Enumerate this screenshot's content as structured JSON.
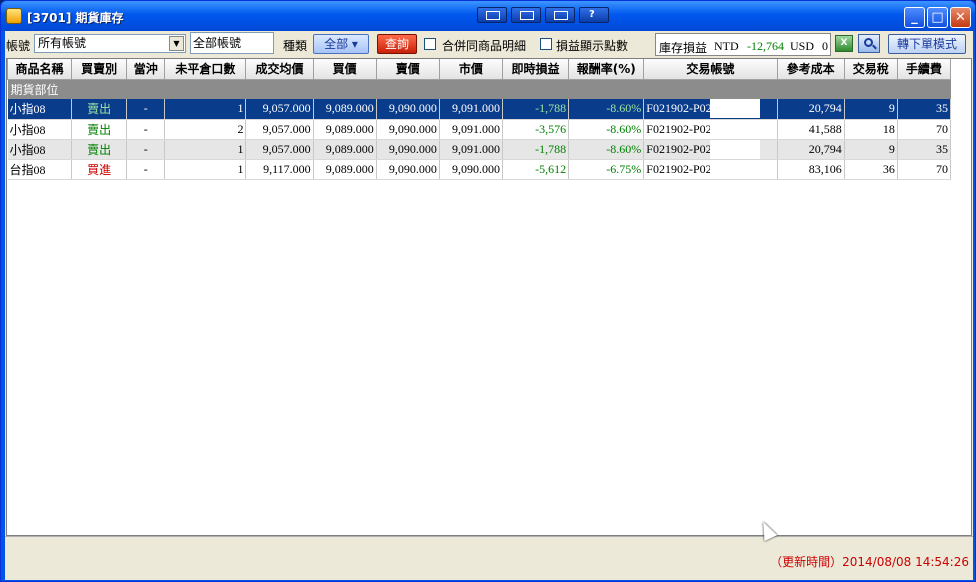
{
  "window": {
    "title": "[3701] 期貨庫存",
    "controls": [
      "minimize",
      "maximize",
      "close"
    ],
    "toolbar_icons": [
      "layout-icon",
      "window-icon",
      "dock-icon",
      "help-icon"
    ],
    "help_label": "?"
  },
  "toolbar": {
    "account_label": "帳號",
    "account_select": "所有帳號",
    "account_text": "全部帳號",
    "type_label": "種類",
    "type_button": "全部",
    "query_button": "查詢",
    "merge_label": "合併同商品明細",
    "points_label": "損益顯示點數",
    "pl_label": "庫存損益",
    "pl_ntd_label": "NTD",
    "pl_ntd_value": "-12,764",
    "pl_usd_label": "USD",
    "pl_usd_value": "0",
    "order_mode_button": "轉下單模式",
    "excel_icon": "excel-icon",
    "search_icon": "search-icon"
  },
  "grid": {
    "columns": [
      "商品名稱",
      "買賣別",
      "當沖",
      "未平倉口數",
      "成交均價",
      "買價",
      "賣價",
      "市價",
      "即時損益",
      "報酬率(%)",
      "交易帳號",
      "參考成本",
      "交易稅",
      "手續費"
    ],
    "group_label": "期貨部位",
    "rows": [
      {
        "name": "小指08",
        "side": "賣出",
        "daytrade": "-",
        "qty": "1",
        "avg": "9,057.000",
        "bid": "9,089.000",
        "ask": "9,090.000",
        "mkt": "9,091.000",
        "pl": "-1,788",
        "ret": "-8.60%",
        "acct": "F021902-P02",
        "cost": "20,794",
        "tax": "9",
        "fee": "35"
      },
      {
        "name": "小指08",
        "side": "賣出",
        "daytrade": "-",
        "qty": "2",
        "avg": "9,057.000",
        "bid": "9,089.000",
        "ask": "9,090.000",
        "mkt": "9,091.000",
        "pl": "-3,576",
        "ret": "-8.60%",
        "acct": "F021902-P02",
        "cost": "41,588",
        "tax": "18",
        "fee": "70"
      },
      {
        "name": "小指08",
        "side": "賣出",
        "daytrade": "-",
        "qty": "1",
        "avg": "9,057.000",
        "bid": "9,089.000",
        "ask": "9,090.000",
        "mkt": "9,091.000",
        "pl": "-1,788",
        "ret": "-8.60%",
        "acct": "F021902-P02",
        "cost": "20,794",
        "tax": "9",
        "fee": "35"
      },
      {
        "name": "台指08",
        "side": "買進",
        "daytrade": "-",
        "qty": "1",
        "avg": "9,117.000",
        "bid": "9,089.000",
        "ask": "9,090.000",
        "mkt": "9,090.000",
        "pl": "-5,612",
        "ret": "-6.75%",
        "acct": "F021902-P02",
        "cost": "83,106",
        "tax": "36",
        "fee": "70"
      }
    ]
  },
  "status": {
    "update_time": "（更新時間）2014/08/08 14:54:26"
  }
}
